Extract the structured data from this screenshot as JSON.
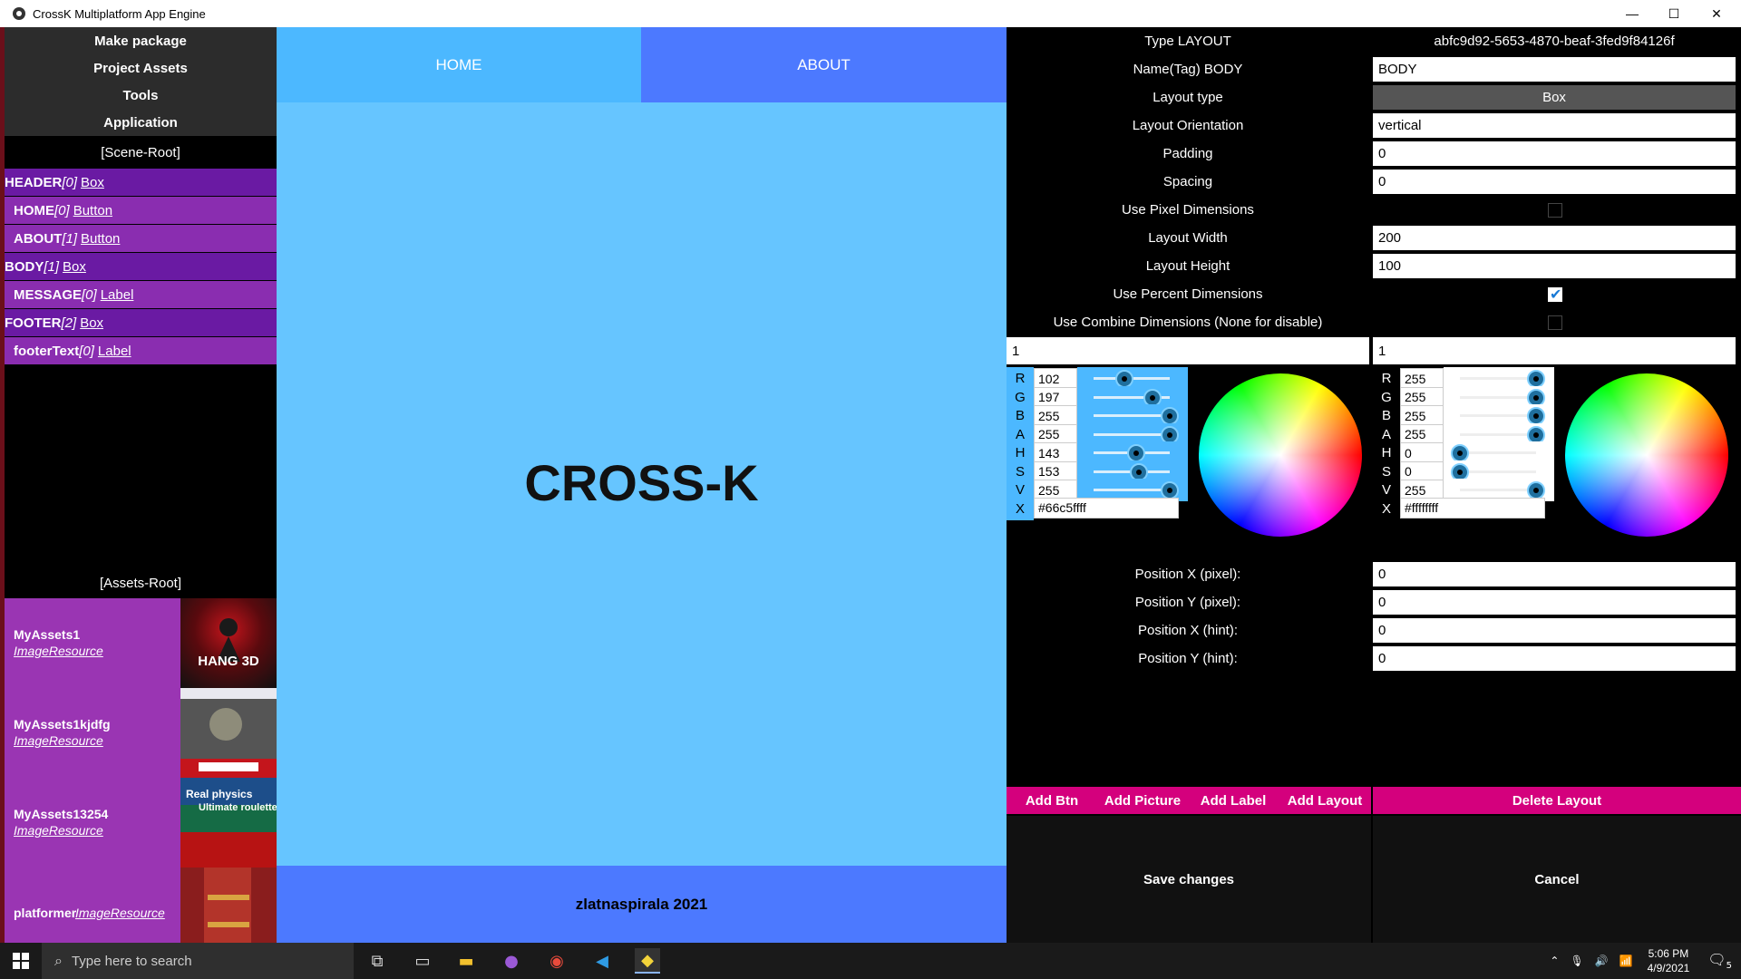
{
  "window": {
    "title": "CrossK Multiplatform App Engine",
    "minimize": "—",
    "maximize": "☐",
    "close": "✕"
  },
  "left": {
    "menu": [
      "Make package",
      "Project Assets",
      "Tools",
      "Application"
    ],
    "scene_root": "[Scene-Root]",
    "tree": [
      {
        "name": "HEADER",
        "index": "[0]",
        "type": "Box"
      },
      {
        "name": "HOME",
        "index": "[0]",
        "type": "Button"
      },
      {
        "name": "ABOUT",
        "index": "[1]",
        "type": "Button"
      },
      {
        "name": "BODY",
        "index": "[1]",
        "type": "Box"
      },
      {
        "name": "MESSAGE",
        "index": "[0]",
        "type": "Label"
      },
      {
        "name": "FOOTER",
        "index": "[2]",
        "type": "Box"
      },
      {
        "name": "footerText",
        "index": "[0]",
        "type": "Label"
      }
    ],
    "assets_root": "[Assets-Root]",
    "assets": [
      {
        "name": "MyAssets1",
        "type": "ImageResource",
        "thumb_text": "HANG 3D"
      },
      {
        "name": "MyAssets1kjdfg",
        "type": "ImageResource",
        "thumb_text": ""
      },
      {
        "name": "MyAssets13254",
        "type": "ImageResource",
        "thumb_text": "Real physics",
        "thumb_text2": "Ultimate roulette"
      },
      {
        "name": "platformer",
        "type": "ImageResource",
        "thumb_text": ""
      }
    ]
  },
  "preview": {
    "home": "HOME",
    "about": "ABOUT",
    "message": "CROSS-K",
    "footer": "zlatnaspirala 2021"
  },
  "props": {
    "type_label": "Type LAYOUT",
    "id": "abfc9d92-5653-4870-beaf-3fed9f84126f",
    "name_label": "Name(Tag) BODY",
    "name_value": "BODY",
    "layout_type_label": "Layout type",
    "layout_type_value": "Box",
    "orientation_label": "Layout Orientation",
    "orientation_value": "vertical",
    "padding_label": "Padding",
    "padding_value": "0",
    "spacing_label": "Spacing",
    "spacing_value": "0",
    "pixel_dims_label": "Use Pixel Dimensions",
    "width_label": "Layout Width",
    "width_value": "200",
    "height_label": "Layout Height",
    "height_value": "100",
    "percent_dims_label": "Use Percent Dimensions",
    "combine_label": "Use Combine Dimensions (None for disable)",
    "combine_a": "1",
    "combine_b": "1",
    "posx_px_label": "Position X (pixel):",
    "posx_px_value": "0",
    "posy_px_label": "Position Y (pixel):",
    "posy_px_value": "0",
    "posx_hint_label": "Position X (hint):",
    "posx_hint_value": "0",
    "posy_hint_label": "Position Y (hint):",
    "posy_hint_value": "0",
    "pixel_dims_checked": false,
    "percent_dims_checked": true,
    "combine_checked": false
  },
  "picker1": {
    "rows": [
      {
        "letter": "R",
        "value": "102",
        "level": 0.4
      },
      {
        "letter": "G",
        "value": "197",
        "level": 0.773
      },
      {
        "letter": "B",
        "value": "255",
        "level": 1
      },
      {
        "letter": "A",
        "value": "255",
        "level": 1
      },
      {
        "letter": "H",
        "value": "143",
        "level": 0.56
      },
      {
        "letter": "S",
        "value": "153",
        "level": 0.6
      },
      {
        "letter": "V",
        "value": "255",
        "level": 1
      }
    ],
    "hex_letter": "X",
    "hex": "#66c5ffff"
  },
  "picker2": {
    "rows": [
      {
        "letter": "R",
        "value": "255",
        "level": 1
      },
      {
        "letter": "G",
        "value": "255",
        "level": 1
      },
      {
        "letter": "B",
        "value": "255",
        "level": 1
      },
      {
        "letter": "A",
        "value": "255",
        "level": 1
      },
      {
        "letter": "H",
        "value": "0",
        "level": 0
      },
      {
        "letter": "S",
        "value": "0",
        "level": 0
      },
      {
        "letter": "V",
        "value": "255",
        "level": 1
      }
    ],
    "hex_letter": "X",
    "hex": "#ffffffff"
  },
  "actions": {
    "add_btn": "Add Btn",
    "add_picture": "Add Picture",
    "add_label": "Add Label",
    "add_layout": "Add Layout",
    "delete_layout": "Delete Layout",
    "save": "Save changes",
    "cancel": "Cancel"
  },
  "taskbar": {
    "search_placeholder": "Type here to search",
    "time": "5:06 PM",
    "date": "4/9/2021",
    "notifications": "5"
  },
  "colors": {
    "accent": "#d4007d",
    "preview_bg": "#66c5ff",
    "home_btn": "#4cb8ff",
    "about_btn": "#4c79ff",
    "tree_root": "#6a1aa3",
    "tree_child": "#8a2db0",
    "assets_bg": "#9a35b3"
  }
}
